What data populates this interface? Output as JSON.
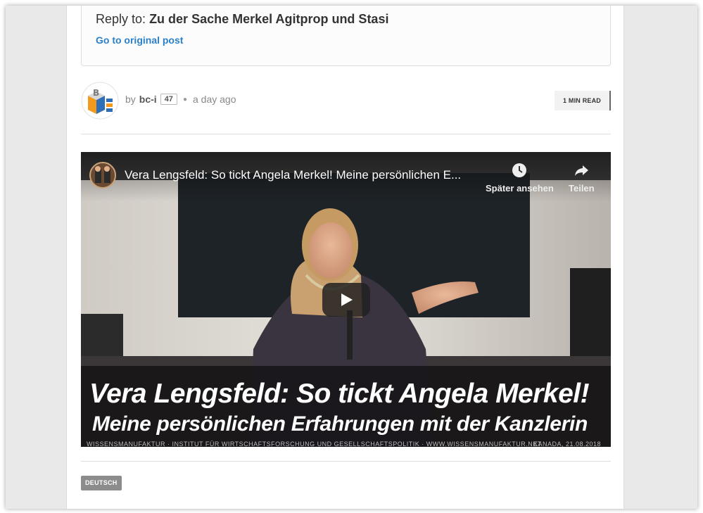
{
  "reply": {
    "prefix": "Reply to:",
    "title": "Zu der Sache Merkel Agitprop und Stasi",
    "original_link": "Go to original post"
  },
  "post_meta": {
    "by": "by",
    "author": "bc-i",
    "reputation": "47",
    "time": "a day ago",
    "read_time": "1 MIN READ"
  },
  "video": {
    "title": "Vera Lengsfeld: So tickt Angela Merkel! Meine persönlichen E...",
    "watch_later": "Später ansehen",
    "share": "Teilen",
    "banner_line1": "Vera Lengsfeld: So tickt Angela Merkel!",
    "banner_line2": "Meine persönlichen Erfahrungen mit der Kanzlerin",
    "footer_text": "WISSENSMANUFAKTUR · INSTITUT FÜR WIRTSCHAFTSFORSCHUNG UND GESELLSCHAFTSPOLITIK · WWW.WISSENSMANUFAKTUR.NET",
    "footer_date": "KANADA, 21.08.2018"
  },
  "tags": [
    "DEUTSCH"
  ],
  "colors": {
    "link": "#2a80c8",
    "tag_bg": "#8c8c8c",
    "avatar_orange": "#f39a1e",
    "avatar_blue": "#2e6fb7"
  }
}
